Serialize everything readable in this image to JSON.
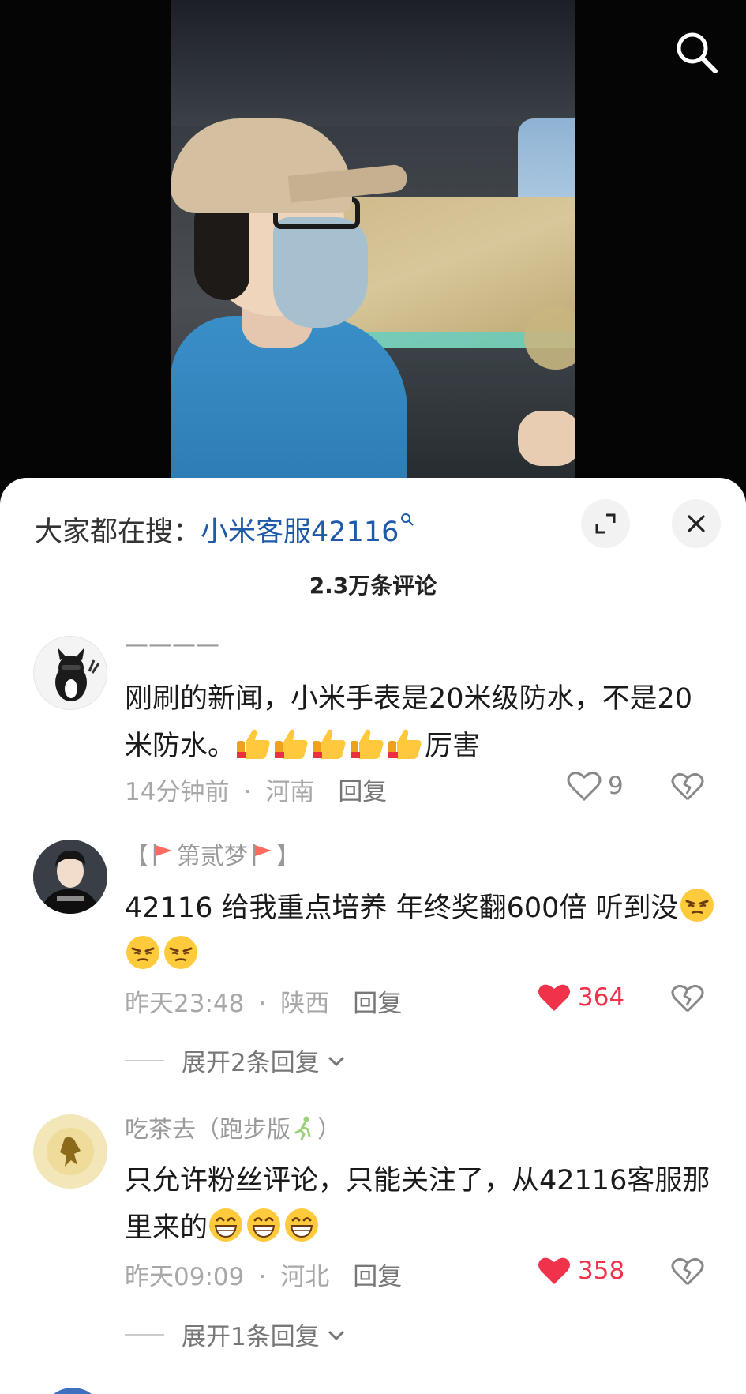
{
  "hot_search": {
    "label": "大家都在搜：",
    "query": "小米客服42116"
  },
  "comment_count": "2.3万条评论",
  "comments": [
    {
      "username": "————",
      "text_before_emoji": "刚刷的新闻，小米手表是20米级防水，不是20米防水。",
      "emoji": "thumbs-up-icon",
      "emoji_count": 5,
      "text_after_emoji": "厉害",
      "time": "14分钟前",
      "location": "河南",
      "reply_label": "回复",
      "likes": "9",
      "liked": false
    },
    {
      "username_prefix": "【",
      "username_name": "第贰梦",
      "username_suffix": "】",
      "text_before_emoji": "42116 给我重点培养 年终奖翻600倍 听到没",
      "emoji": "smirk-face-icon",
      "emoji_count": 3,
      "time": "昨天23:48",
      "location": "陕西",
      "reply_label": "回复",
      "likes": "364",
      "liked": true,
      "expand_replies": "展开2条回复"
    },
    {
      "username_name": "吃茶去（跑步版",
      "username_suffix": "）",
      "text_before_emoji": "只允许粉丝评论，只能关注了，从42116客服那里来的",
      "emoji": "grin-face-icon",
      "emoji_count": 3,
      "time": "昨天09:09",
      "location": "河北",
      "reply_label": "回复",
      "likes": "358",
      "liked": true,
      "expand_replies": "展开1条回复"
    }
  ],
  "colors": {
    "like_red": "#f0324a",
    "link_blue": "#1e5aa8",
    "muted": "#a8a8a8"
  }
}
